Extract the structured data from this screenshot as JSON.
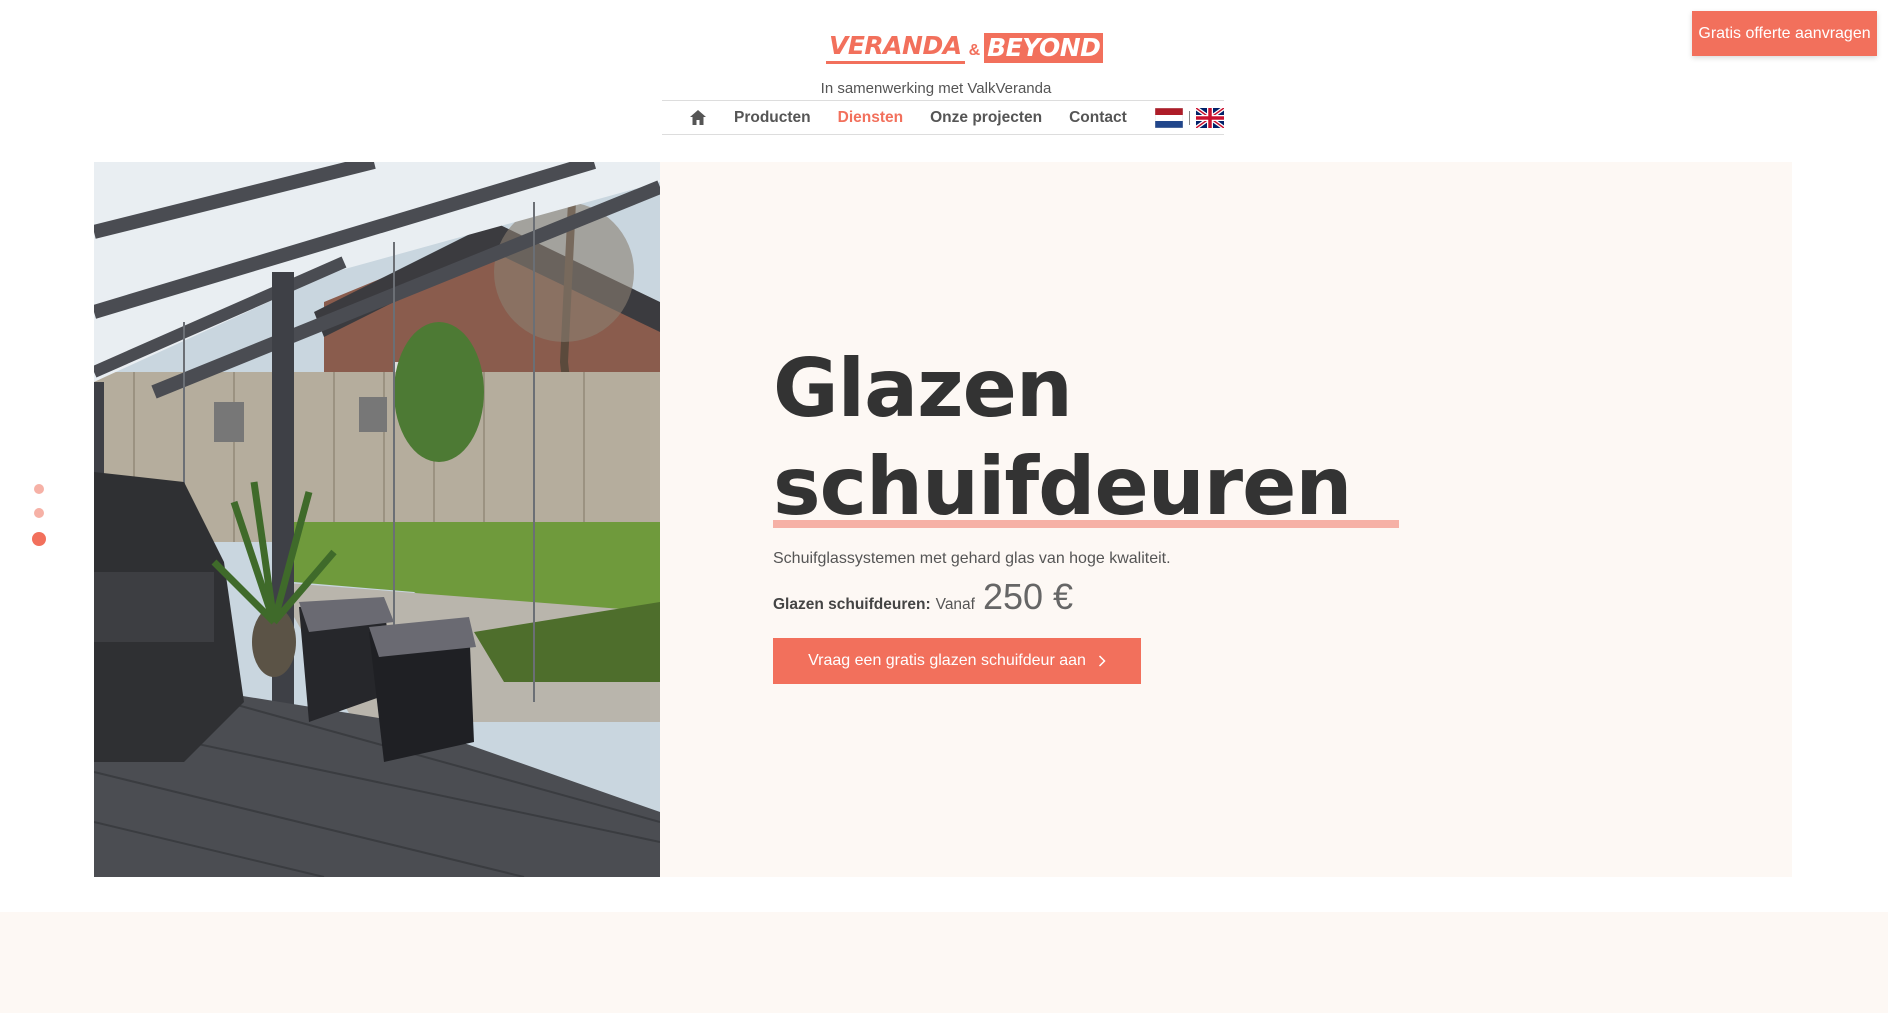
{
  "header": {
    "logo_left": "VERANDA",
    "logo_amp": "&",
    "logo_right": "BEYOND",
    "tagline": "In samenwerking met ValkVeranda",
    "cta_label": "Gratis offerte aanvragen"
  },
  "nav": {
    "home_icon": "home-icon",
    "items": [
      "Producten",
      "Diensten",
      "Onze projecten",
      "Contact"
    ],
    "active": "Diensten",
    "languages": [
      "nl-flag-icon",
      "uk-flag-icon"
    ]
  },
  "hero": {
    "title_line1": "Glazen",
    "title_line2": "schuifdeuren",
    "subtitle": "Schuifglassystemen met gehard glas van hoge kwaliteit.",
    "price_label": "Glazen schuifdeuren:",
    "price_prefix": "Vanaf",
    "price_value": "250 €",
    "button_label": "Vraag een gratis glazen schuifdeur aan",
    "image_icon": "veranda-photo"
  },
  "slider": {
    "dot_count": 3,
    "active_index": 3
  },
  "colors": {
    "accent": "#f2705c",
    "accent_light": "#f6b1a6",
    "panel_bg": "#fdf8f4",
    "text_dark": "#333333"
  }
}
